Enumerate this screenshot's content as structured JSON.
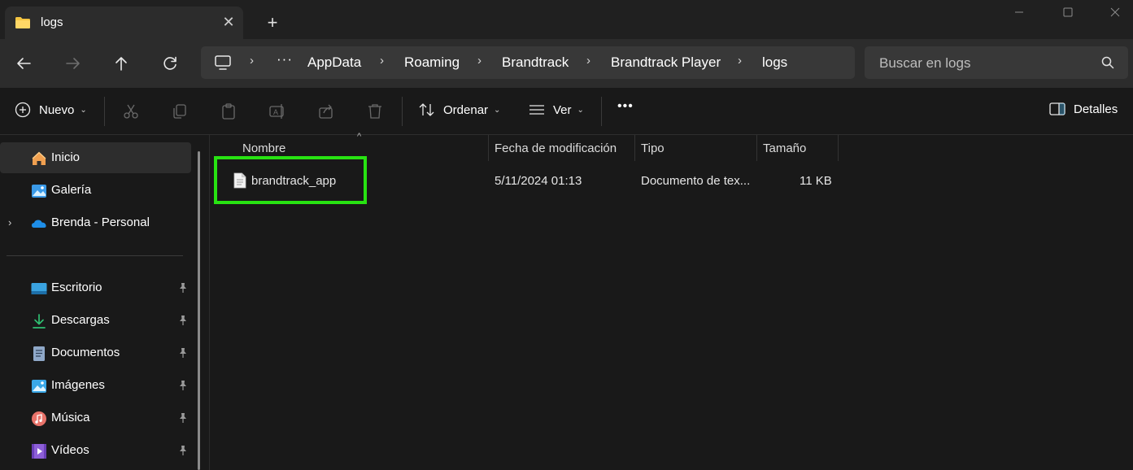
{
  "tab": {
    "title": "logs",
    "close_glyph": "✕",
    "new_tab_glyph": "+"
  },
  "window_controls": {
    "minimize": "minimize-icon",
    "maximize": "maximize-icon",
    "close": "close-icon"
  },
  "breadcrumb": {
    "overflow": "···",
    "items": [
      "AppData",
      "Roaming",
      "Brandtrack",
      "Brandtrack Player",
      "logs"
    ],
    "separator": "›"
  },
  "search": {
    "placeholder": "Buscar en logs"
  },
  "commands": {
    "new_label": "Nuevo",
    "sort_label": "Ordenar",
    "view_label": "Ver",
    "more_label": "•••",
    "details_label": "Detalles"
  },
  "sidebar": {
    "top_items": [
      {
        "label": "Inicio",
        "icon": "home-icon",
        "selected": true
      },
      {
        "label": "Galería",
        "icon": "gallery-icon"
      },
      {
        "label": "Brenda - Personal",
        "icon": "onedrive-cloud-icon",
        "expandable": true
      }
    ],
    "pinned_items": [
      {
        "label": "Escritorio",
        "icon": "desktop-icon"
      },
      {
        "label": "Descargas",
        "icon": "download-icon"
      },
      {
        "label": "Documentos",
        "icon": "documents-icon"
      },
      {
        "label": "Imágenes",
        "icon": "pictures-icon"
      },
      {
        "label": "Música",
        "icon": "music-icon"
      },
      {
        "label": "Vídeos",
        "icon": "videos-icon"
      }
    ]
  },
  "columns": {
    "name": "Nombre",
    "modified": "Fecha de modificación",
    "type": "Tipo",
    "size": "Tamaño"
  },
  "files": [
    {
      "name": "brandtrack_app",
      "modified": "5/11/2024 01:13",
      "type": "Documento de tex...",
      "size": "11 KB"
    }
  ],
  "colors": {
    "highlight": "#28e312",
    "folder": "#f4c542",
    "accent": "#4cc2ff"
  }
}
